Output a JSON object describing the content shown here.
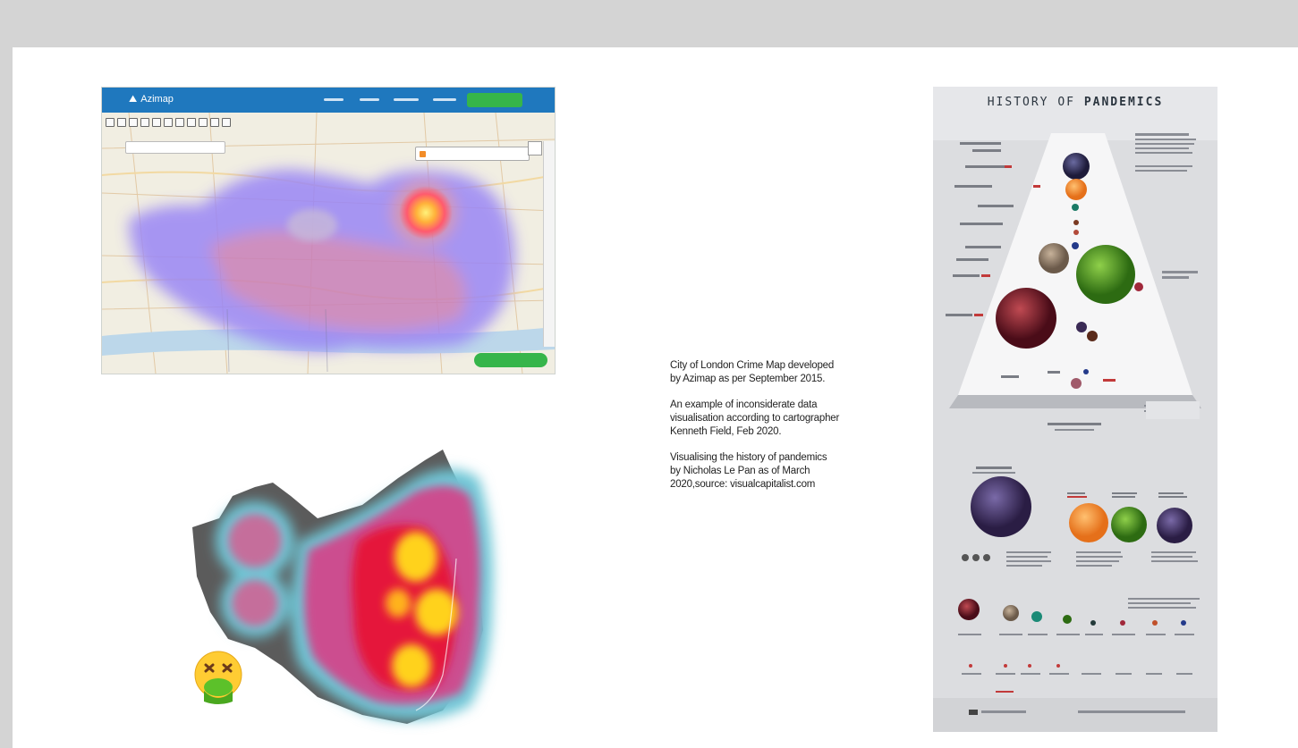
{
  "azimap": {
    "logo": "Azimap",
    "cta_label": "",
    "layer_label": "",
    "scale_label": "",
    "export_label": ""
  },
  "china_map": {
    "caption": ""
  },
  "description": {
    "paragraph_1": "City of London Crime Map developed by Azimap as per September 2015.",
    "paragraph_2": "An example of inconsiderate data visualisation according to cartographer Kenneth Field, Feb 2020.",
    "paragraph_3": "Visualising the history of pandemics by Nicholas Le Pan as of March 2020,source: visualcapitalist.com"
  },
  "infographic": {
    "title_light": "HISTORY OF",
    "title_bold": "PANDEMICS"
  },
  "colors": {
    "background": "#d4d4d4",
    "slide": "#ffffff",
    "azimap_header": "#1f78be",
    "azimap_green": "#36b54a",
    "heat_purple": "#8a7cf0",
    "heat_hot": "#ffd21e"
  },
  "icons": [
    "azimap-logo-icon",
    "nauseated-face-emoji-icon"
  ]
}
